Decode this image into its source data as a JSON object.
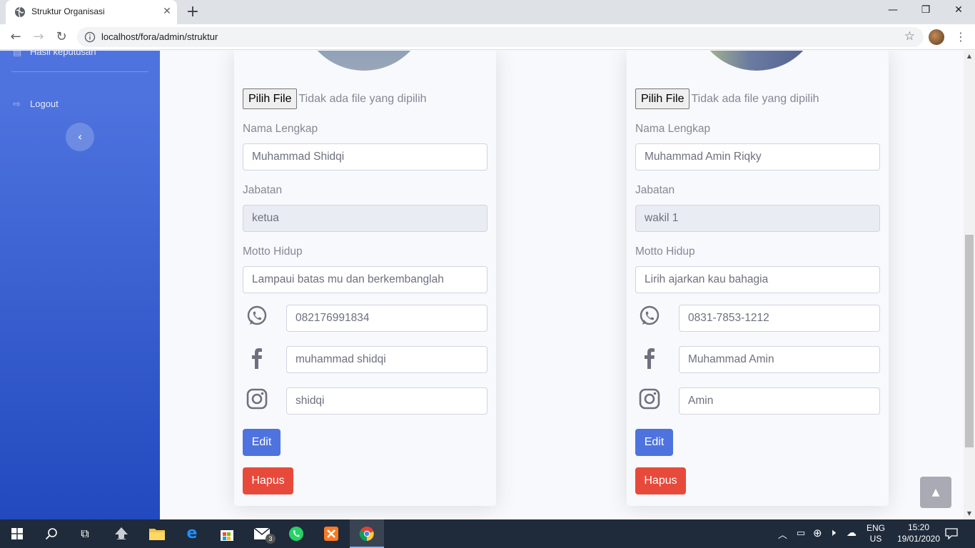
{
  "browser": {
    "tab_title": "Struktur Organisasi",
    "tab_close": "✕",
    "new_tab": "+",
    "url": "localhost/fora/admin/struktur",
    "window_buttons": {
      "minimize": "—",
      "restore": "❐",
      "close": "✕"
    }
  },
  "sidebar": {
    "items": [
      {
        "label": "Hasil keputusan",
        "icon": "clipboard-icon"
      },
      {
        "label": "Logout",
        "icon": "sign-out-icon"
      }
    ],
    "toggle_glyph": "‹"
  },
  "cards": [
    {
      "file_button": "Pilih File",
      "file_status": "Tidak ada file yang dipilih",
      "name_label": "Nama Lengkap",
      "name_value": "Muhammad Shidqi",
      "position_label": "Jabatan",
      "position_value": "ketua",
      "motto_label": "Motto Hidup",
      "motto_value": "Lampaui batas mu dan berkembanglah",
      "whatsapp": "082176991834",
      "facebook": "muhammad shidqi",
      "instagram": "shidqi",
      "edit_label": "Edit",
      "delete_label": "Hapus"
    },
    {
      "file_button": "Pilih File",
      "file_status": "Tidak ada file yang dipilih",
      "name_label": "Nama Lengkap",
      "name_value": "Muhammad Amin Riqky",
      "position_label": "Jabatan",
      "position_value": "wakil 1",
      "motto_label": "Motto Hidup",
      "motto_value": "Lirih ajarkan kau bahagia",
      "whatsapp": "0831-7853-1212",
      "facebook": "Muhammad Amin",
      "instagram": "Amin",
      "edit_label": "Edit",
      "delete_label": "Hapus"
    }
  ],
  "scroll_top_glyph": "▲",
  "taskbar": {
    "lang_top": "ENG",
    "lang_bottom": "US",
    "time": "15:20",
    "date": "19/01/2020",
    "mail_badge": "3"
  },
  "colors": {
    "primary": "#4e73df",
    "danger": "#e74a3b",
    "sidebar_gradient_start": "#4e73df",
    "sidebar_gradient_end": "#224abe",
    "taskbar": "#1f2a3a"
  }
}
